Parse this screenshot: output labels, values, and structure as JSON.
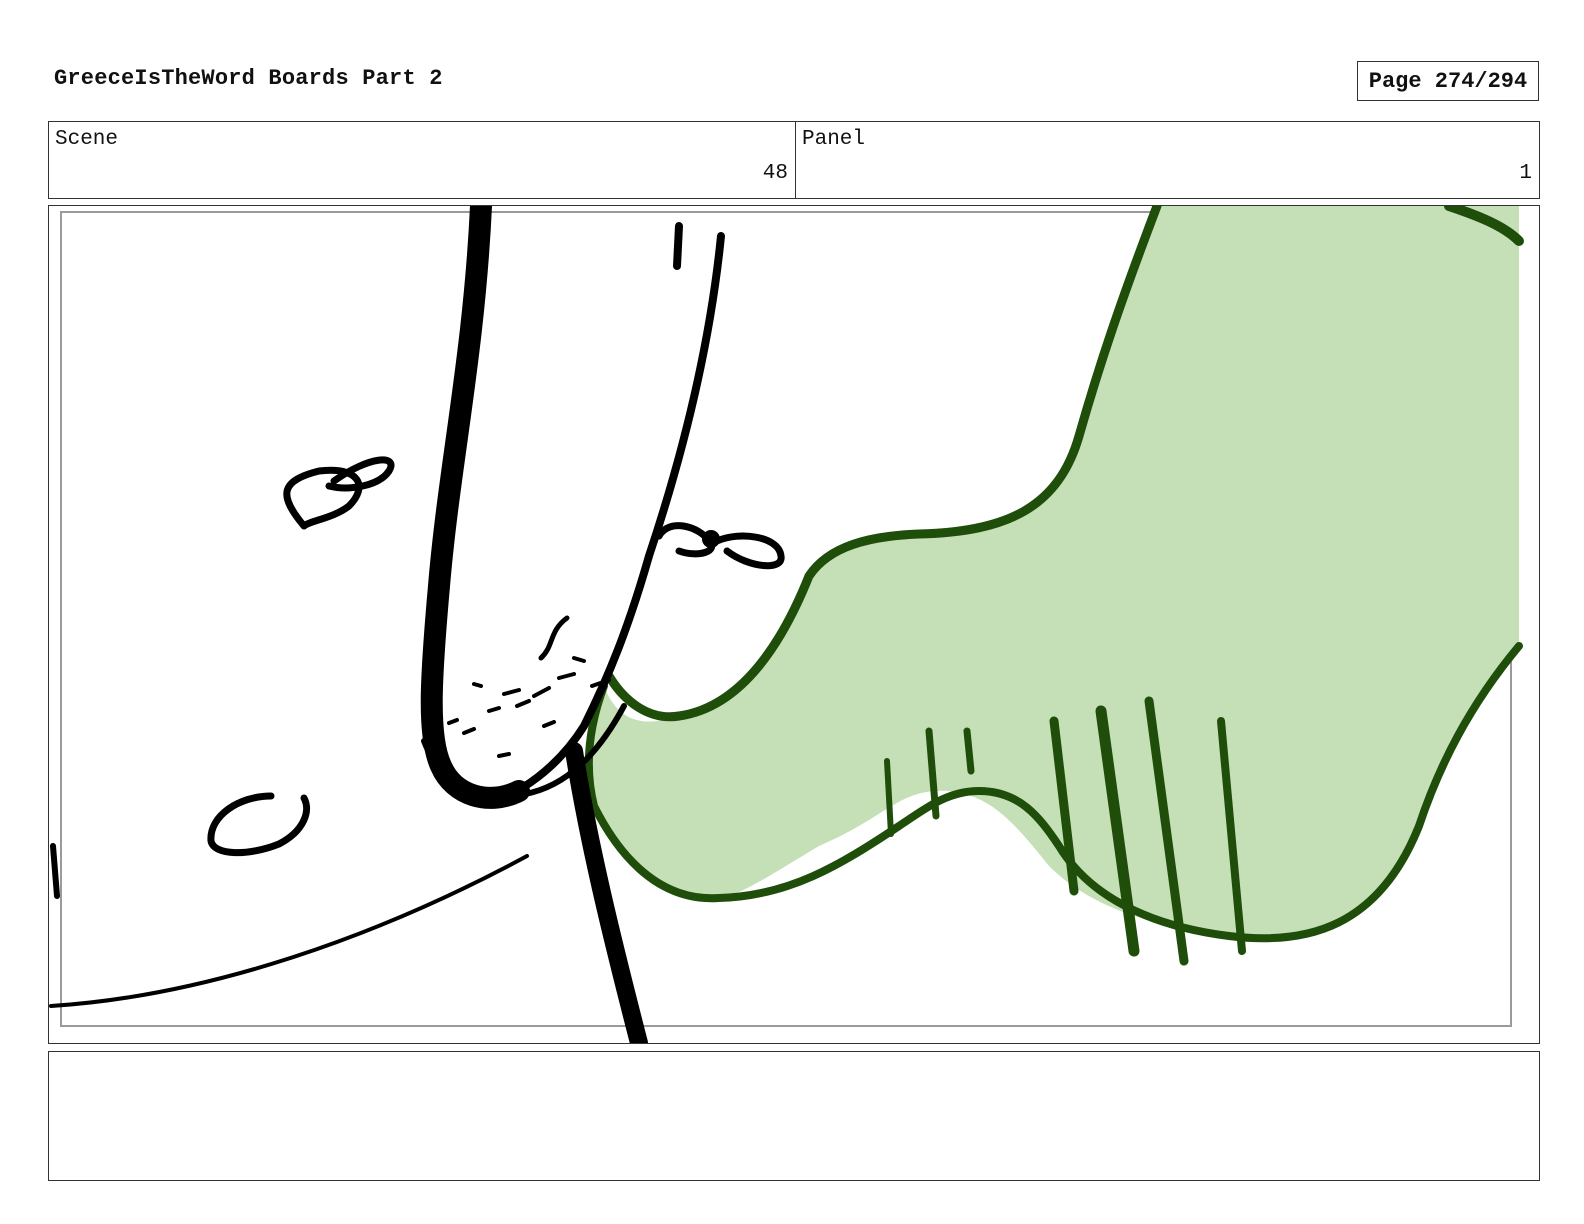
{
  "document": {
    "title": "GreeceIsTheWord Boards Part 2",
    "page_indicator": "Page 274/294"
  },
  "meta": {
    "scene_label": "Scene",
    "scene_value": "48",
    "panel_label": "Panel",
    "panel_value": "1"
  },
  "colors": {
    "sketch_ink": "#000000",
    "highlight_fill": "#c5dfb6",
    "highlight_stroke": "#1f4d0a",
    "border": "#333333"
  },
  "notes": {
    "text": ""
  }
}
